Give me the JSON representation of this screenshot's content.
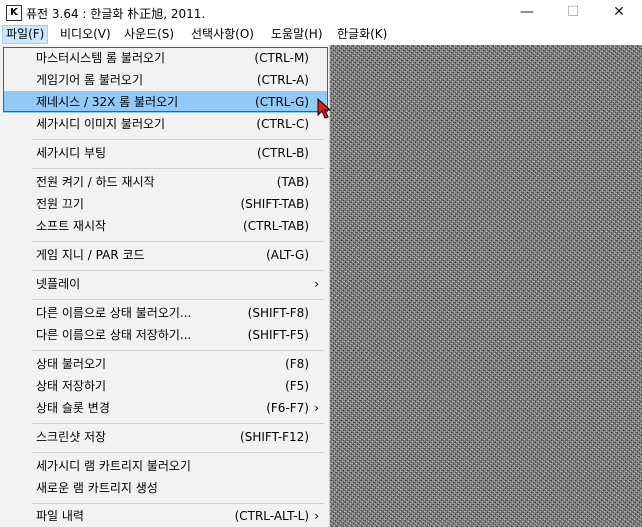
{
  "window": {
    "title": "퓨전 3.64 : 한글화 朴正旭, 2011.",
    "app_icon_label": "K"
  },
  "menubar": [
    {
      "label": "파일(F)",
      "active": true
    },
    {
      "label": "비디오(V)"
    },
    {
      "label": "사운드(S)"
    },
    {
      "label": "선택사항(O)"
    },
    {
      "label": "도움말(H)"
    },
    {
      "label": "한글화(K)"
    }
  ],
  "file_menu": [
    {
      "label": "마스터시스템 롬 불러오기",
      "shortcut": "(CTRL-M)"
    },
    {
      "label": "게임기어 롬 불러오기",
      "shortcut": "(CTRL-A)"
    },
    {
      "label": "제네시스 / 32X 롬 불러오기",
      "shortcut": "(CTRL-G)",
      "highlighted": true
    },
    {
      "label": "세가시디 이미지 불러오기",
      "shortcut": "(CTRL-C)"
    },
    {
      "label": "세가시디 부팅",
      "shortcut": "(CTRL-B)"
    },
    {
      "label": "전원 켜기 / 하드 재시작",
      "shortcut": "(TAB)"
    },
    {
      "label": "전원 끄기",
      "shortcut": "(SHIFT-TAB)"
    },
    {
      "label": "소프트 재시작",
      "shortcut": "(CTRL-TAB)"
    },
    {
      "label": "게임 지니 / PAR 코드",
      "shortcut": "(ALT-G)"
    },
    {
      "label": "넷플레이",
      "shortcut": "",
      "submenu": true
    },
    {
      "label": "다른 이름으로 상태 불러오기...",
      "shortcut": "(SHIFT-F8)"
    },
    {
      "label": "다른 이름으로 상태 저장하기...",
      "shortcut": "(SHIFT-F5)"
    },
    {
      "label": "상태 불러오기",
      "shortcut": "(F8)"
    },
    {
      "label": "상태 저장하기",
      "shortcut": "(F5)"
    },
    {
      "label": "상태 슬롯 변경",
      "shortcut": "(F6-F7)",
      "submenu": true
    },
    {
      "label": "스크린샷 저장",
      "shortcut": "(SHIFT-F12)"
    },
    {
      "label": "세가시디 램 카트리지 불러오기",
      "shortcut": ""
    },
    {
      "label": "새로운 램 카트리지 생성",
      "shortcut": ""
    },
    {
      "label": "파일 내력",
      "shortcut": "(CTRL-ALT-L)",
      "submenu": true
    }
  ],
  "submenu_arrow": "›",
  "colors": {
    "highlight": "#91c9f7",
    "menubar_active": "#cce8ff",
    "annotation_box": "#dd2222"
  }
}
